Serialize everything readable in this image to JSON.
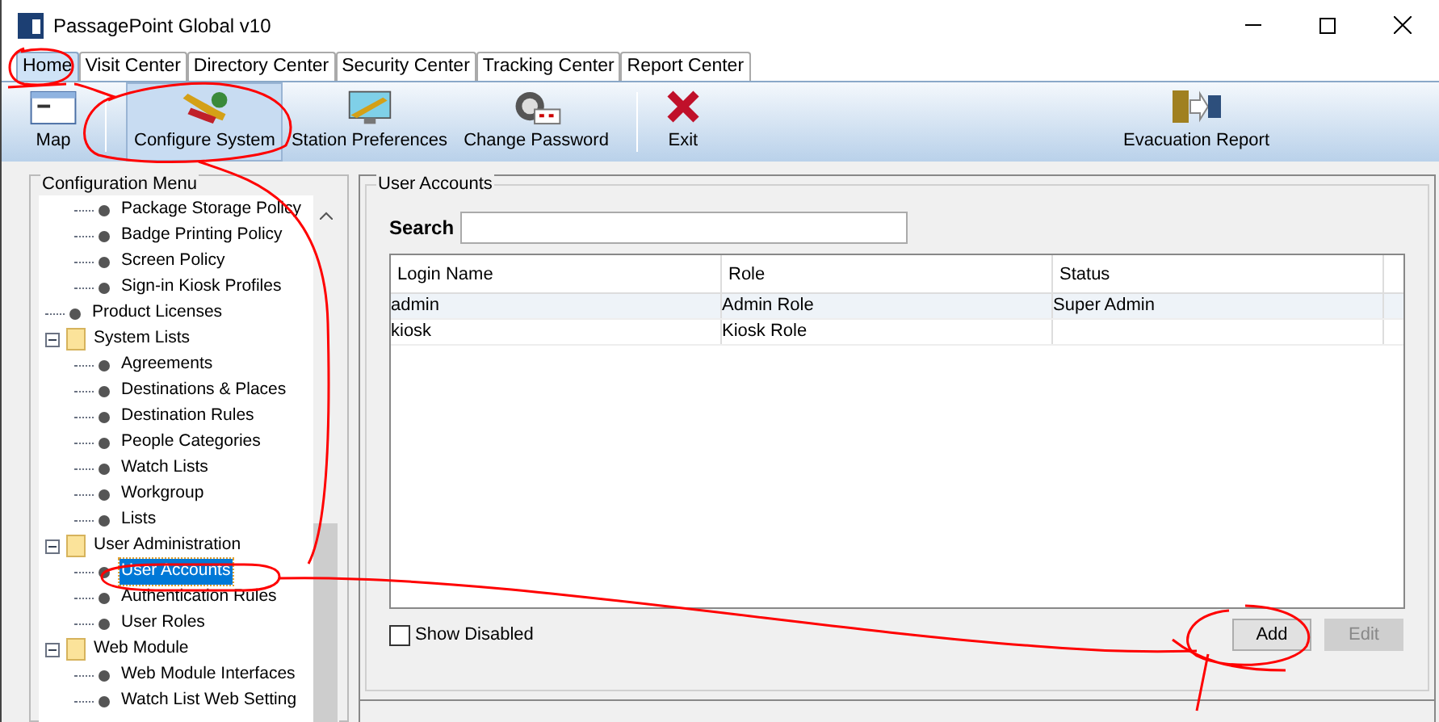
{
  "window": {
    "title": "PassagePoint Global v10"
  },
  "tabs": [
    {
      "label": "Home",
      "selected": true
    },
    {
      "label": "Visit Center",
      "selected": false
    },
    {
      "label": "Directory Center",
      "selected": false
    },
    {
      "label": "Security Center",
      "selected": false
    },
    {
      "label": "Tracking Center",
      "selected": false
    },
    {
      "label": "Report Center",
      "selected": false
    }
  ],
  "toolbar": [
    {
      "label": "Map",
      "kind": "map",
      "selected": false
    },
    {
      "label": "Configure System",
      "kind": "configure",
      "selected": true
    },
    {
      "label": "Station Preferences",
      "kind": "station",
      "selected": false
    },
    {
      "label": "Change Password",
      "kind": "password",
      "selected": false
    },
    {
      "label": "Exit",
      "kind": "exit",
      "selected": false
    },
    {
      "label": "Evacuation Report",
      "kind": "evacuation",
      "selected": false
    }
  ],
  "sidebar": {
    "title": "Configuration Menu",
    "items": [
      {
        "children": [
          {
            "label": "Package Storage Policy",
            "selected": false
          },
          {
            "label": "Badge Printing Policy",
            "selected": false
          },
          {
            "label": "Screen Policy",
            "selected": false
          },
          {
            "label": "Sign-in Kiosk Profiles",
            "selected": false
          }
        ]
      },
      {
        "label": "Product Licenses",
        "selected": false
      },
      {
        "label": "System Lists",
        "selected": false,
        "expanded": true,
        "children": [
          {
            "label": "Agreements",
            "selected": false
          },
          {
            "label": "Destinations & Places",
            "selected": false
          },
          {
            "label": "Destination Rules",
            "selected": false
          },
          {
            "label": "People Categories",
            "selected": false
          },
          {
            "label": "Watch Lists",
            "selected": false
          },
          {
            "label": "Workgroup",
            "selected": false
          },
          {
            "label": "Lists",
            "selected": false
          }
        ]
      },
      {
        "label": "User Administration",
        "selected": false,
        "expanded": true,
        "children": [
          {
            "label": "User Accounts",
            "selected": true
          },
          {
            "label": "Authentication Rules",
            "selected": false
          },
          {
            "label": "User Roles",
            "selected": false
          }
        ]
      },
      {
        "label": "Web Module",
        "selected": false,
        "expanded": true,
        "children": [
          {
            "label": "Web Module Interfaces",
            "selected": false
          },
          {
            "label": "Watch List Web Setting",
            "selected": false
          }
        ]
      }
    ]
  },
  "panel": {
    "title": "User Accounts",
    "search": {
      "label": "Search"
    },
    "table": {
      "columns": [
        "Login Name",
        "Role",
        "Status"
      ],
      "rows": [
        {
          "cells": [
            "admin",
            "Admin Role",
            "Super Admin"
          ],
          "selected": true
        },
        {
          "cells": [
            "kiosk",
            "Kiosk Role",
            ""
          ],
          "selected": false
        }
      ]
    },
    "show_disabled": {
      "label": "Show Disabled",
      "checked": false
    },
    "buttons": [
      {
        "label": "Add",
        "disabled": false
      },
      {
        "label": "Edit",
        "disabled": true
      }
    ]
  }
}
